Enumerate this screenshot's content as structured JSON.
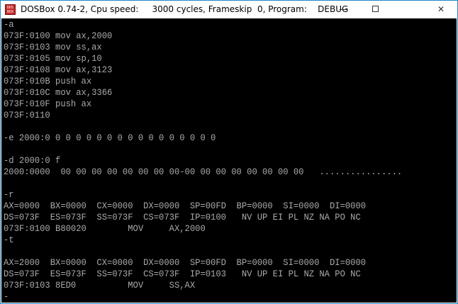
{
  "window": {
    "title": "DOSBox 0.74-2, Cpu speed:     3000 cycles, Frameskip  0, Program:    DEBUG",
    "icon_label": "DOS BOX",
    "controls": {
      "minimize": "minimize-icon",
      "maximize": "maximize-icon",
      "close": "✕"
    }
  },
  "colors": {
    "terminal_background": "#000000",
    "terminal_text": "#aaaaaa",
    "window_border": "#1e88c8"
  },
  "terminal": {
    "lines": [
      "-a",
      "073F:0100 mov ax,2000",
      "073F:0103 mov ss,ax",
      "073F:0105 mov sp,10",
      "073F:0108 mov ax,3123",
      "073F:010B push ax",
      "073F:010C mov ax,3366",
      "073F:010F push ax",
      "073F:0110",
      "",
      "-e 2000:0 0 0 0 0 0 0 0 0 0 0 0 0 0 0 0 0",
      "",
      "-d 2000:0 f",
      "2000:0000  00 00 00 00 00 00 00 00-00 00 00 00 00 00 00 00   ................",
      "",
      "-r",
      "AX=0000  BX=0000  CX=0000  DX=0000  SP=00FD  BP=0000  SI=0000  DI=0000",
      "DS=073F  ES=073F  SS=073F  CS=073F  IP=0100   NV UP EI PL NZ NA PO NC",
      "073F:0100 B80020        MOV     AX,2000",
      "-t",
      "",
      "AX=2000  BX=0000  CX=0000  DX=0000  SP=00FD  BP=0000  SI=0000  DI=0000",
      "DS=073F  ES=073F  SS=073F  CS=073F  IP=0103   NV UP EI PL NZ NA PO NC",
      "073F:0103 8ED0          MOV     SS,AX",
      "-"
    ]
  }
}
